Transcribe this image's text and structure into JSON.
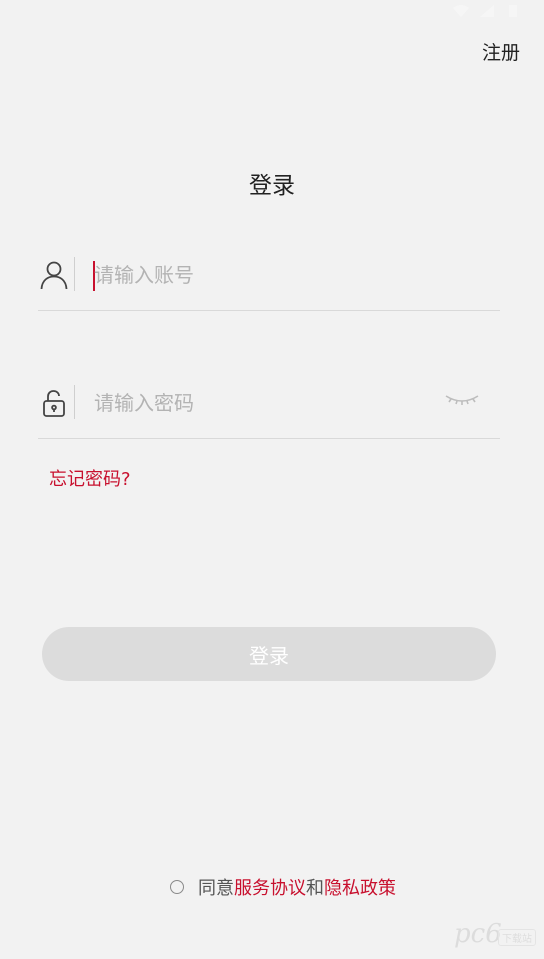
{
  "header": {
    "register_label": "注册"
  },
  "title": "登录",
  "account": {
    "placeholder": "请输入账号",
    "value": ""
  },
  "password": {
    "placeholder": "请输入密码",
    "value": ""
  },
  "forgot_label": "忘记密码?",
  "login_label": "登录",
  "agreement": {
    "prefix": "同意",
    "terms": "服务协议",
    "conj": "和",
    "privacy": "隐私政策",
    "checked": false
  },
  "watermark": {
    "text": "pc6",
    "tag": "下载站"
  },
  "colors": {
    "accent": "#c8102e",
    "background": "#f2f2f2",
    "button_disabled": "#dcdcdc"
  },
  "icons": {
    "account": "user-icon",
    "password": "unlock-icon",
    "visibility": "eye-closed-icon"
  }
}
